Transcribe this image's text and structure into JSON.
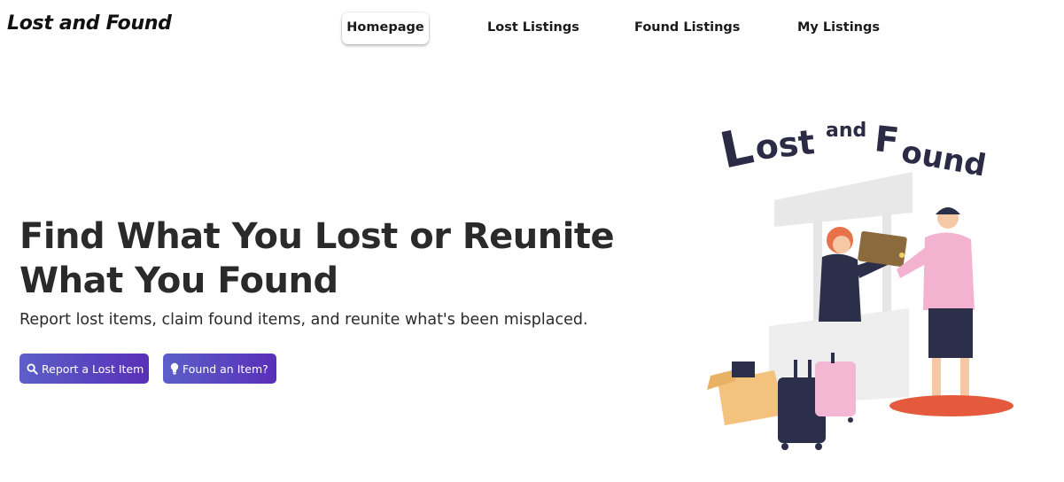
{
  "brand": {
    "logo_text": "Lost and Found"
  },
  "nav": {
    "items": [
      {
        "label": "Homepage",
        "active": true
      },
      {
        "label": "Lost Listings",
        "active": false
      },
      {
        "label": "Found Listings",
        "active": false
      },
      {
        "label": "My Listings",
        "active": false
      }
    ]
  },
  "hero": {
    "title_line1": "Find What You Lost or Reunite",
    "title_line2": "What You Found",
    "subtitle": "Report lost items, claim found items, and reunite what's been misplaced.",
    "report_button": {
      "label": "Report a Lost Item",
      "icon": "search-icon"
    },
    "found_button": {
      "label": "Found an Item?",
      "icon": "lightbulb-icon"
    }
  },
  "illustration": {
    "title_text": "Lost and Found"
  },
  "colors": {
    "button_gradient_start": "#5b5fc9",
    "button_gradient_end": "#5a2fb8",
    "text_dark": "#2a2a2a"
  }
}
